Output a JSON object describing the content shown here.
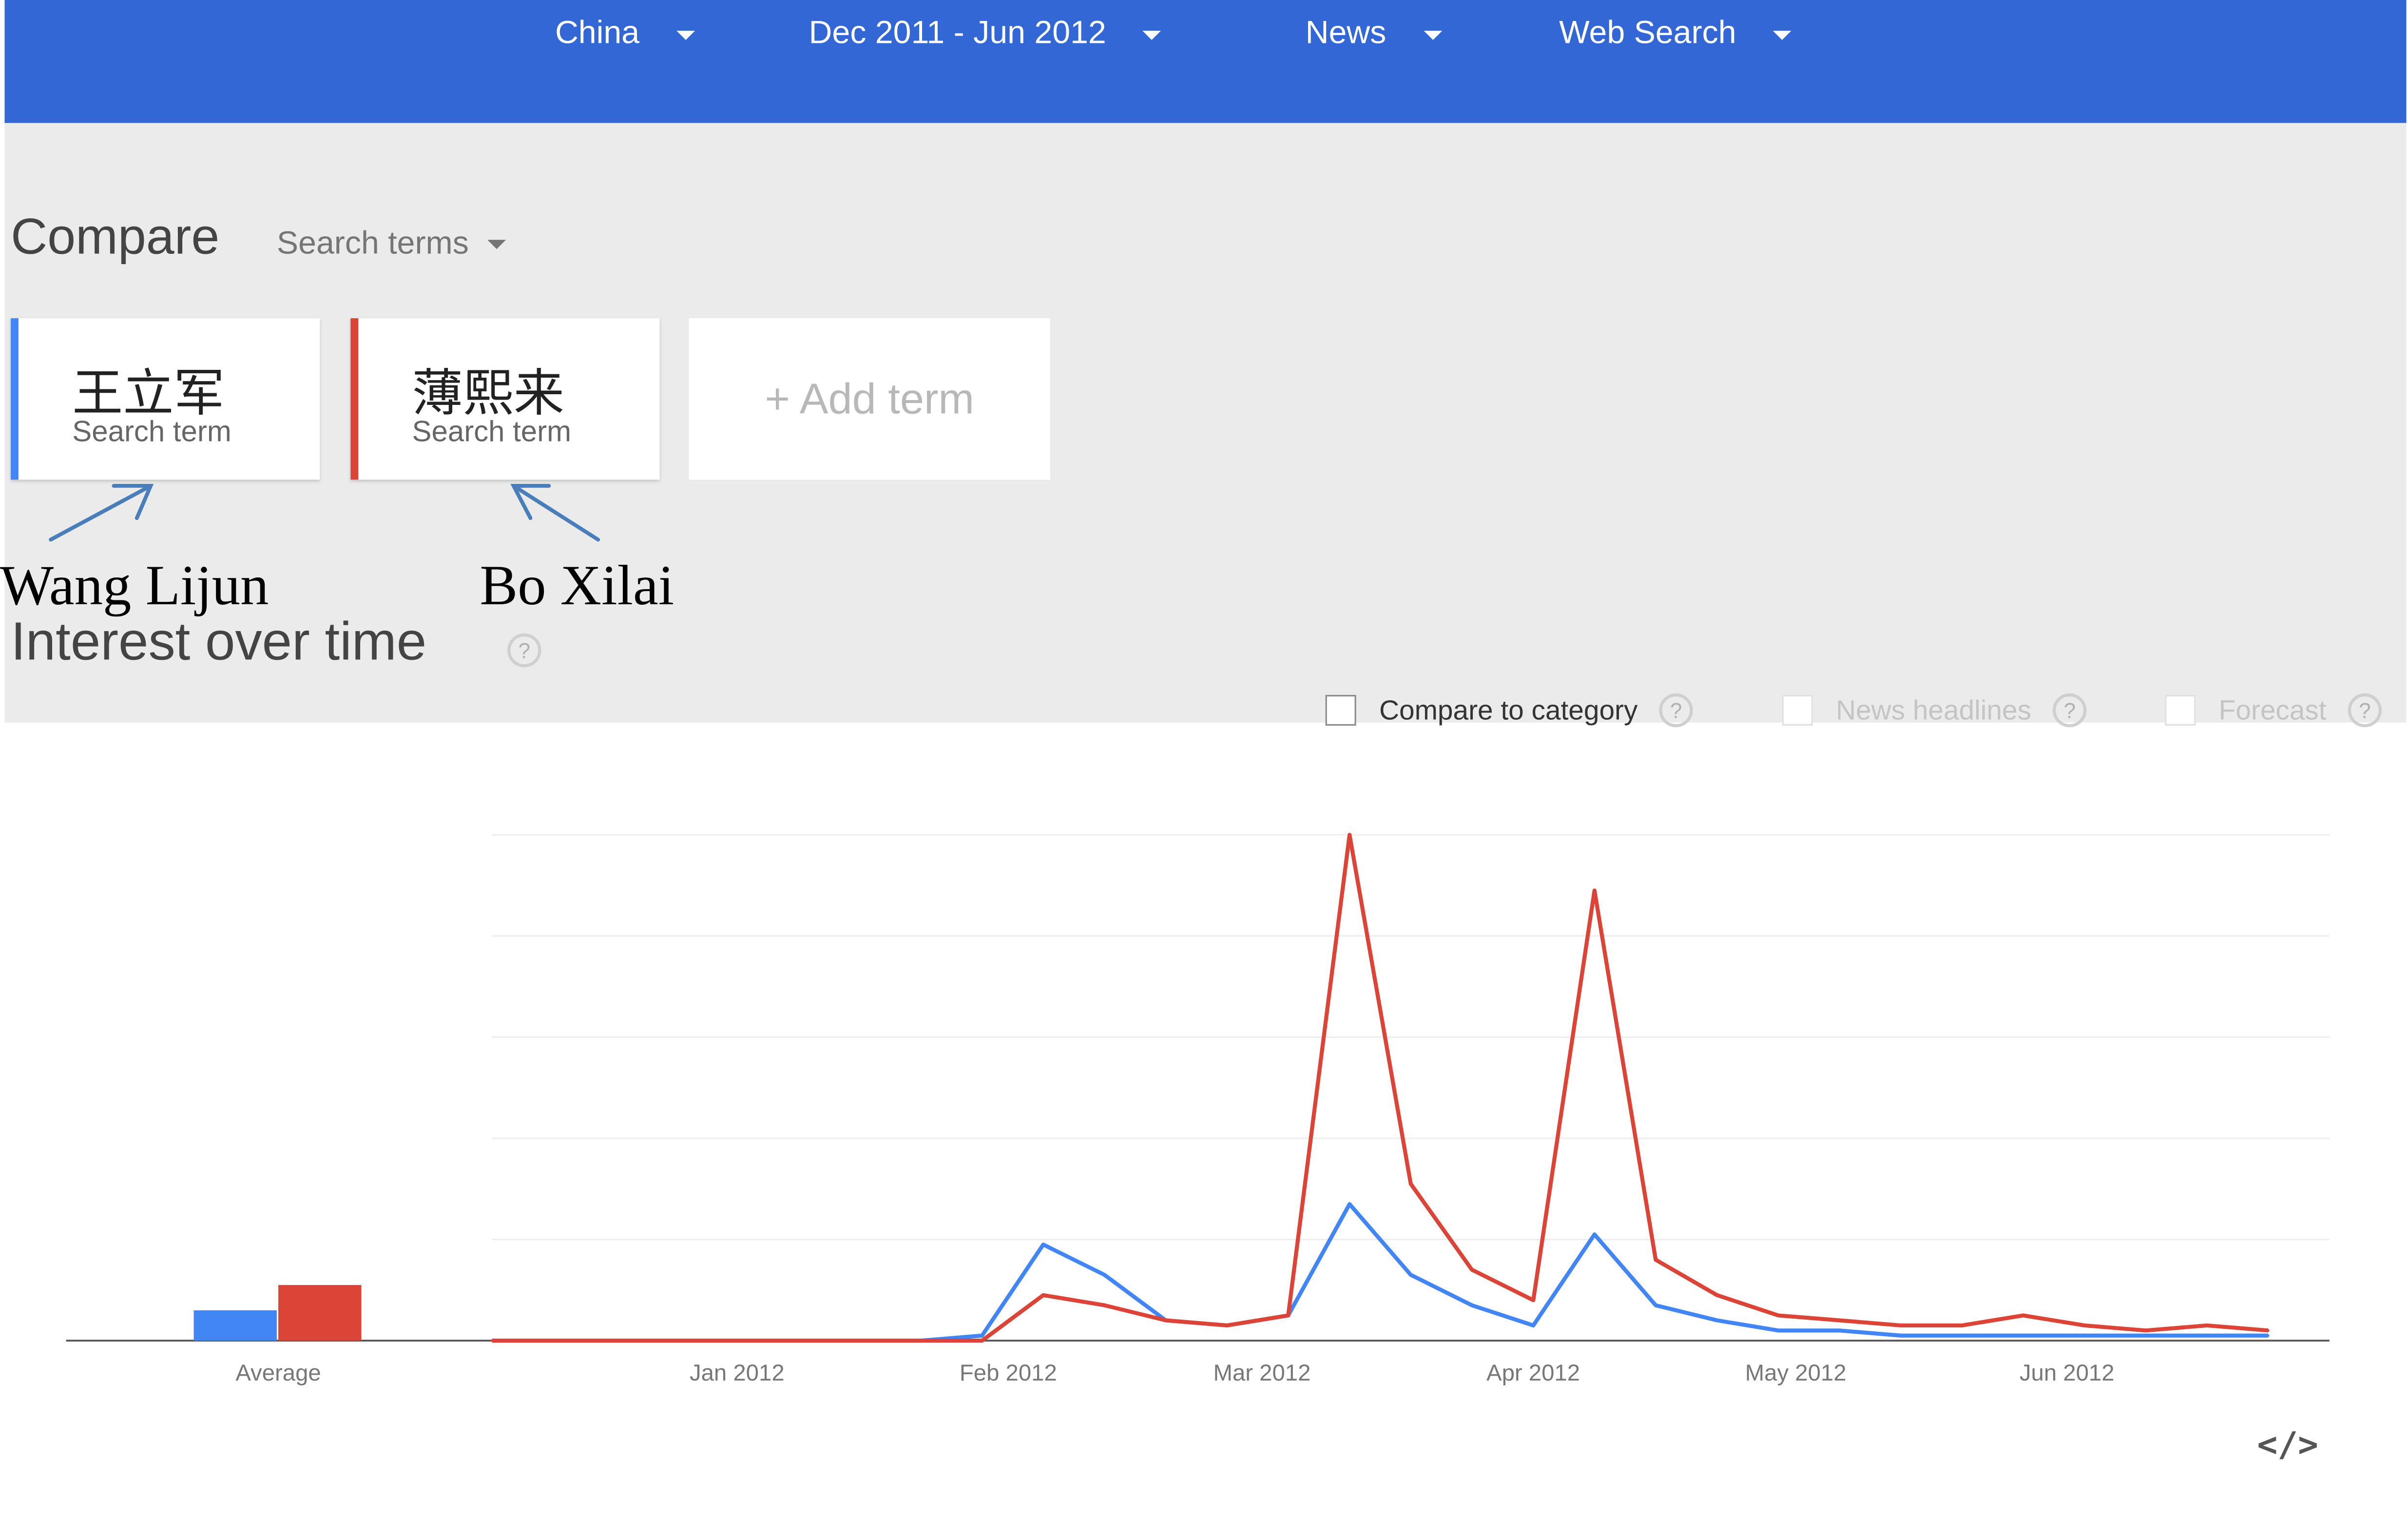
{
  "header": {
    "region": "China",
    "date_range": "Dec 2011 - Jun 2012",
    "category": "News",
    "search_type": "Web Search"
  },
  "compare": {
    "title": "Compare",
    "type": "Search terms"
  },
  "terms": [
    {
      "name": "王立军",
      "subtitle": "Search term",
      "color": "#4285f4"
    },
    {
      "name": "薄熙来",
      "subtitle": "Search term",
      "color": "#db4437"
    }
  ],
  "add_term": "+ Add term",
  "annotations": [
    "Wang Lijun",
    "Bo Xilai"
  ],
  "interest": {
    "title": "Interest over time",
    "help": "?",
    "options": [
      {
        "label": "Compare to category",
        "enabled": true
      },
      {
        "label": "News headlines",
        "enabled": false
      },
      {
        "label": "Forecast",
        "enabled": false
      }
    ]
  },
  "embed_icon": "</>",
  "chart_data": {
    "type": "line",
    "average_bar": {
      "label": "Average",
      "values": [
        6,
        11
      ]
    },
    "x": [
      "2011-12-04",
      "2011-12-11",
      "2011-12-18",
      "2011-12-25",
      "2012-01-01",
      "2012-01-08",
      "2012-01-15",
      "2012-01-22",
      "2012-01-29",
      "2012-02-05",
      "2012-02-12",
      "2012-02-19",
      "2012-02-26",
      "2012-03-04",
      "2012-03-11",
      "2012-03-18",
      "2012-03-25",
      "2012-04-01",
      "2012-04-08",
      "2012-04-15",
      "2012-04-22",
      "2012-04-29",
      "2012-05-06",
      "2012-05-13",
      "2012-05-20",
      "2012-05-27",
      "2012-06-03",
      "2012-06-10",
      "2012-06-17",
      "2012-06-24"
    ],
    "x_ticks": [
      "Jan 2012",
      "Feb 2012",
      "Mar 2012",
      "Apr 2012",
      "May 2012",
      "Jun 2012"
    ],
    "series": [
      {
        "name": "王立军",
        "color": "#4285f4",
        "values": [
          0,
          0,
          0,
          0,
          0,
          0,
          0,
          0,
          1,
          19,
          13,
          4,
          3,
          5,
          27,
          13,
          7,
          3,
          21,
          7,
          4,
          2,
          2,
          1,
          1,
          1,
          1,
          1,
          1,
          1
        ]
      },
      {
        "name": "薄熙来",
        "color": "#db4437",
        "values": [
          0,
          0,
          0,
          0,
          0,
          0,
          0,
          0,
          0,
          9,
          7,
          4,
          3,
          5,
          100,
          31,
          14,
          8,
          89,
          16,
          9,
          5,
          4,
          3,
          3,
          5,
          3,
          2,
          3,
          2
        ]
      }
    ],
    "ylim": [
      0,
      100
    ],
    "grid": true,
    "title": "",
    "xlabel": "",
    "ylabel": ""
  }
}
